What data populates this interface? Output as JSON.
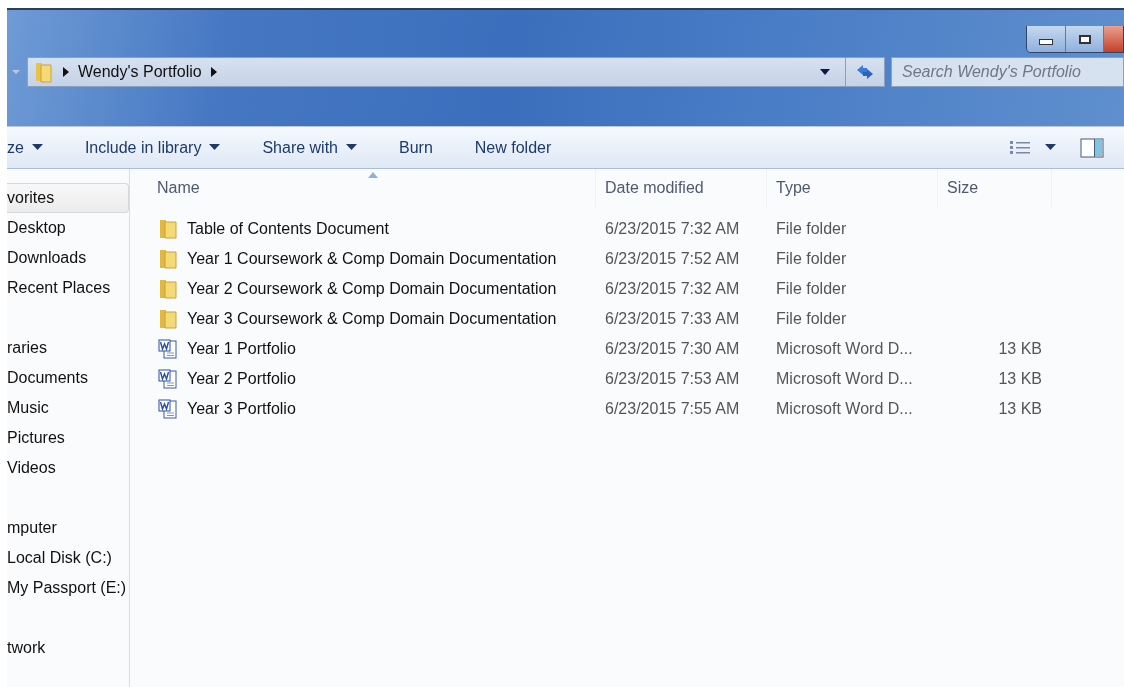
{
  "address": {
    "path": "Wendy's Portfolio"
  },
  "search": {
    "placeholder": "Search Wendy's Portfolio"
  },
  "toolbar": [
    {
      "label": "ze",
      "dropdown": true
    },
    {
      "label": "Include in library",
      "dropdown": true
    },
    {
      "label": "Share with",
      "dropdown": true
    },
    {
      "label": "Burn",
      "dropdown": false
    },
    {
      "label": "New folder",
      "dropdown": false
    }
  ],
  "sidebar": {
    "groups": [
      {
        "items": [
          {
            "label": "vorites",
            "selected": true
          },
          {
            "label": "Desktop",
            "selected": false
          },
          {
            "label": "Downloads",
            "selected": false
          },
          {
            "label": "Recent Places",
            "selected": false
          }
        ]
      },
      {
        "items": [
          {
            "label": "raries",
            "selected": false
          },
          {
            "label": "Documents",
            "selected": false
          },
          {
            "label": "Music",
            "selected": false
          },
          {
            "label": "Pictures",
            "selected": false
          },
          {
            "label": "Videos",
            "selected": false
          }
        ]
      },
      {
        "items": [
          {
            "label": "mputer",
            "selected": false
          },
          {
            "label": "Local Disk (C:)",
            "selected": false
          },
          {
            "label": "My Passport (E:)",
            "selected": false
          }
        ]
      },
      {
        "items": [
          {
            "label": "twork",
            "selected": false
          }
        ]
      }
    ]
  },
  "table": {
    "columns": [
      "Name",
      "Date modified",
      "Type",
      "Size"
    ],
    "rows": [
      {
        "kind": "folder",
        "name": "Table of Contents Document",
        "date": "6/23/2015 7:32 AM",
        "type": "File folder"
      },
      {
        "kind": "folder",
        "name": "Year 1 Coursework & Comp Domain Documentation",
        "date": "6/23/2015 7:52 AM",
        "type": "File folder"
      },
      {
        "kind": "folder",
        "name": "Year 2 Coursework & Comp Domain Documentation",
        "date": "6/23/2015 7:32 AM",
        "type": "File folder"
      },
      {
        "kind": "folder",
        "name": "Year 3 Coursework & Comp Domain Documentation",
        "date": "6/23/2015 7:33 AM",
        "type": "File folder"
      },
      {
        "kind": "word",
        "name": "Year 1 Portfolio",
        "date": "6/23/2015 7:30 AM",
        "type": "Microsoft Word D...",
        "size": "13 KB"
      },
      {
        "kind": "word",
        "name": "Year 2 Portfolio",
        "date": "6/23/2015 7:53 AM",
        "type": "Microsoft Word D...",
        "size": "13 KB"
      },
      {
        "kind": "word",
        "name": "Year 3 Portfolio",
        "date": "6/23/2015 7:55 AM",
        "type": "Microsoft Word D...",
        "size": "13 KB"
      }
    ]
  }
}
